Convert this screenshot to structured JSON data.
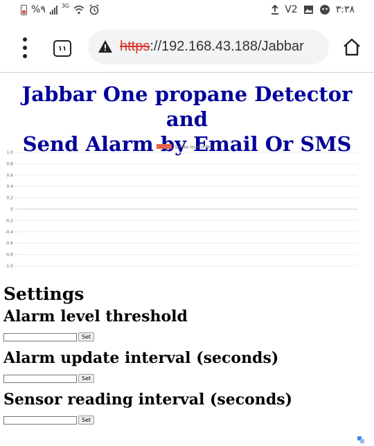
{
  "status_bar": {
    "battery_text": "%٩",
    "network_label": "3G",
    "time": "٣:٣٨",
    "volte": "V2"
  },
  "browser": {
    "tab_count": "١١",
    "url_protocol": "https",
    "url_rest": "://192.168.43.188/Jabbar"
  },
  "page": {
    "title_line1": "Jabbar One propane Detector and",
    "title_line2": "Send Alarm by Email Or SMS"
  },
  "chart_data": {
    "type": "line",
    "title": "",
    "xlabel": "",
    "ylabel": "",
    "series": [
      {
        "name": "Smoke level (PPM)",
        "color": "#e8634f",
        "values": []
      }
    ],
    "y_ticks": [
      "1.0",
      "0.8",
      "0.6",
      "0.4",
      "0.2",
      "0",
      "-0.2",
      "-0.4",
      "-0.6",
      "-0.8",
      "-1.0"
    ],
    "ylim": [
      -1.0,
      1.0
    ],
    "grid": true,
    "legend": "top-center"
  },
  "settings": {
    "heading": "Settings",
    "fields": [
      {
        "label": "Alarm level threshold",
        "value": "",
        "button": "Set"
      },
      {
        "label": "Alarm update interval (seconds)",
        "value": "",
        "button": "Set"
      },
      {
        "label": "Sensor reading interval (seconds)",
        "value": "",
        "button": "Set"
      }
    ]
  }
}
